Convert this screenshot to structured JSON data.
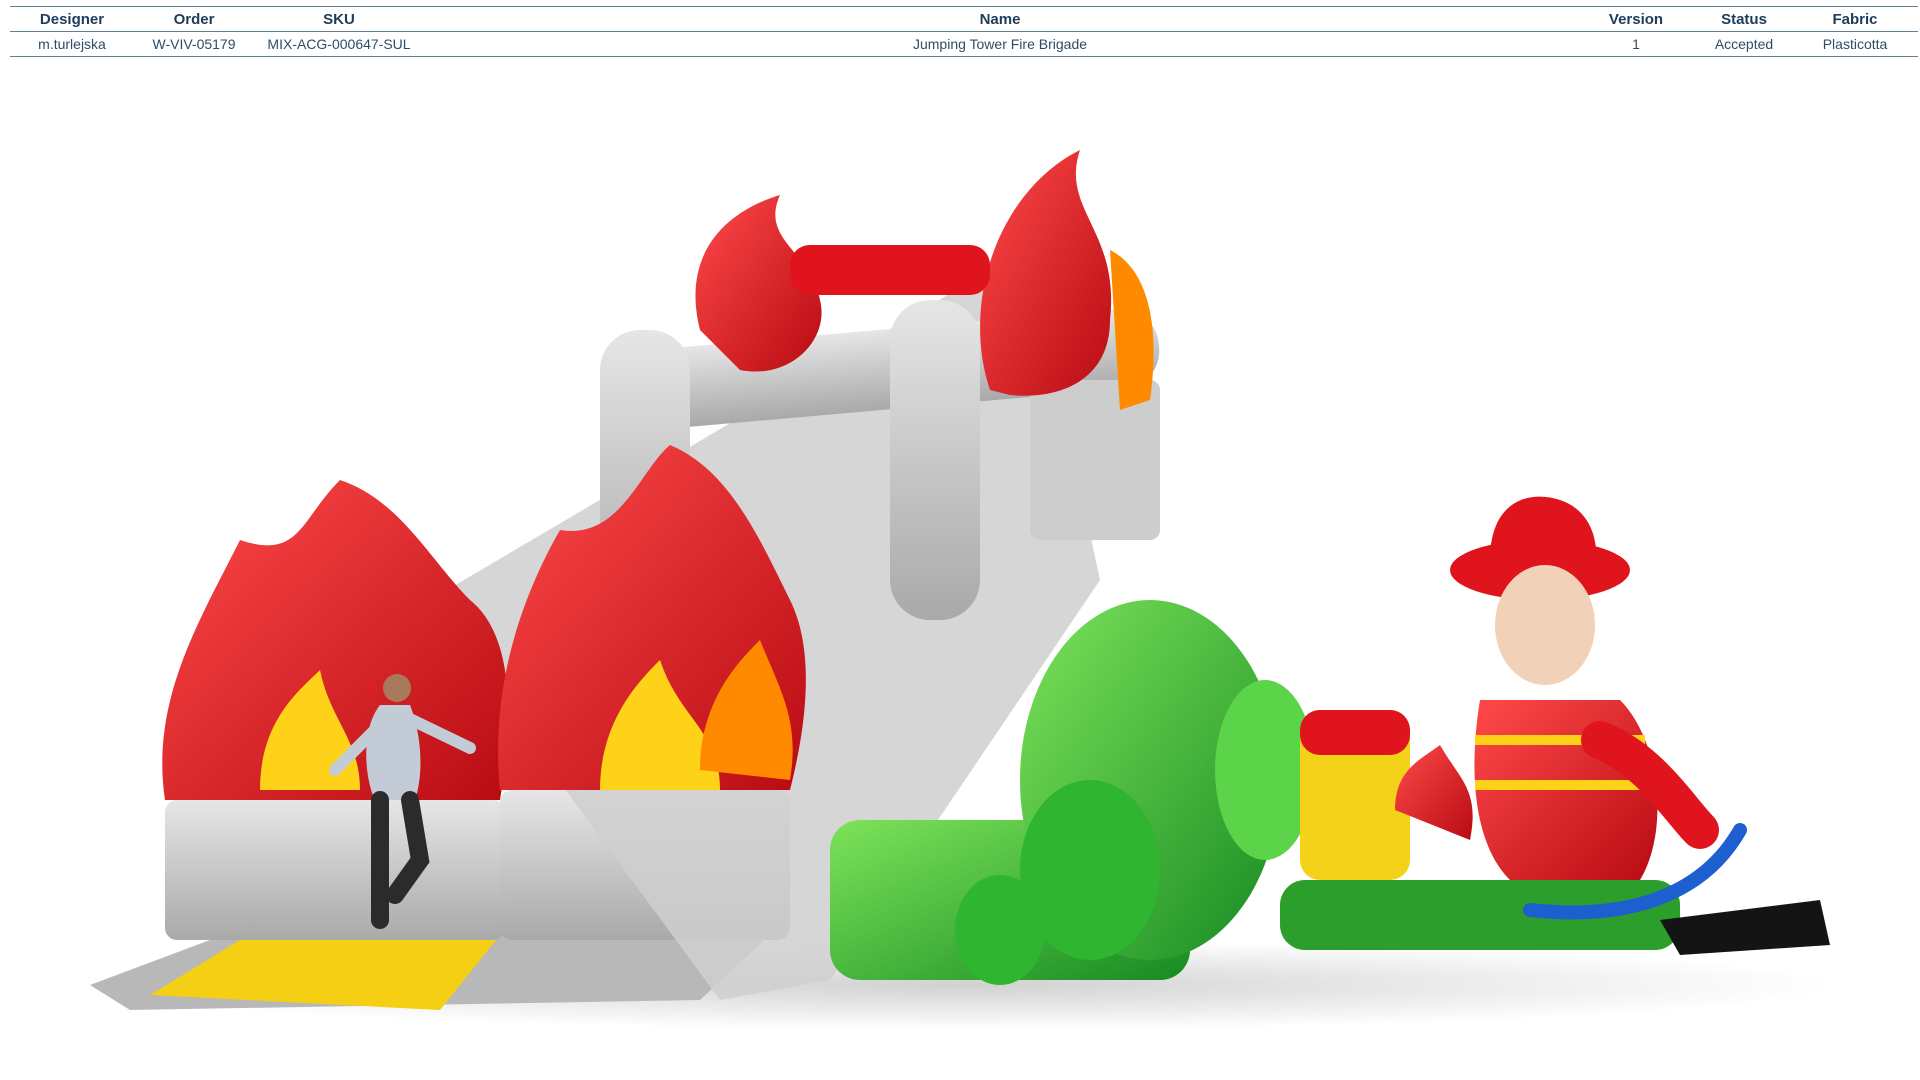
{
  "table": {
    "headers": {
      "designer": "Designer",
      "order": "Order",
      "sku": "SKU",
      "name": "Name",
      "version": "Version",
      "status": "Status",
      "fabric": "Fabric"
    },
    "row": {
      "designer": "m.turlejska",
      "order": "W-VIV-05179",
      "sku": "MIX-ACG-000647-SUL",
      "name": "Jumping Tower Fire Brigade",
      "version": "1",
      "status": "Accepted",
      "fabric": "Plasticotta"
    }
  },
  "colors": {
    "header_text": "#1f3c5a",
    "rule": "#5f7f92",
    "flame_red": "#e0141c",
    "flame_orange": "#ff8a00",
    "flame_yellow": "#ffd21a",
    "gray": "#c9c9c9",
    "green": "#2fb52f",
    "yellow": "#f5d21a"
  }
}
